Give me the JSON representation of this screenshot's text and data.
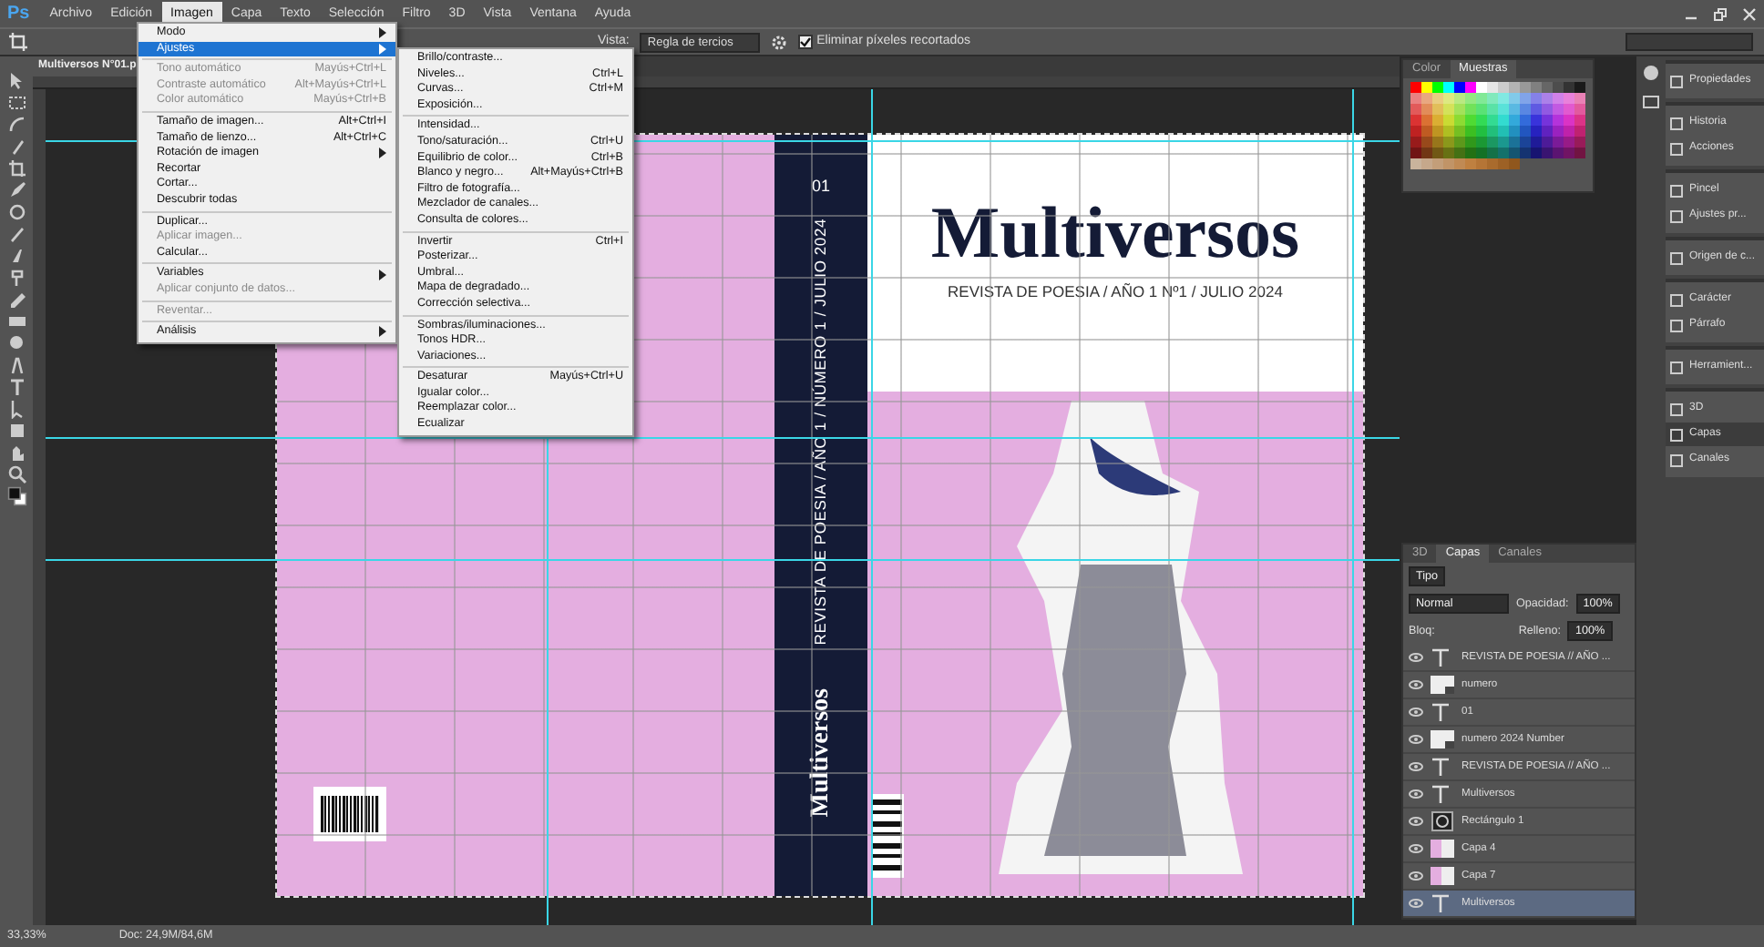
{
  "menubar": {
    "logo": "Ps",
    "items": [
      {
        "label": "Archivo",
        "selected": false
      },
      {
        "label": "Edición",
        "selected": false
      },
      {
        "label": "Imagen",
        "selected": true
      },
      {
        "label": "Capa",
        "selected": false
      },
      {
        "label": "Texto",
        "selected": false
      },
      {
        "label": "Selección",
        "selected": false
      },
      {
        "label": "Filtro",
        "selected": false
      },
      {
        "label": "3D",
        "selected": false
      },
      {
        "label": "Vista",
        "selected": false
      },
      {
        "label": "Ventana",
        "selected": false
      },
      {
        "label": "Ayuda",
        "selected": false
      }
    ]
  },
  "options_bar": {
    "view_label": "Vista:",
    "view_value": "Regla de tercios",
    "delete_pixels": {
      "label": "Eliminar píxeles recortados",
      "checked": true
    }
  },
  "document_tab": {
    "title": "Multiversos N°01.p"
  },
  "image_menu": {
    "items": [
      {
        "kind": "item",
        "label": "Modo",
        "submenu": true,
        "selected": false,
        "disabled": false
      },
      {
        "kind": "item",
        "label": "Ajustes",
        "submenu": true,
        "selected": true,
        "disabled": false
      },
      {
        "kind": "separator"
      },
      {
        "kind": "item",
        "label": "Tono automático",
        "shortcut": "Mayús+Ctrl+L",
        "submenu": false,
        "selected": false,
        "disabled": true
      },
      {
        "kind": "item",
        "label": "Contraste automático",
        "shortcut": "Alt+Mayús+Ctrl+L",
        "submenu": false,
        "selected": false,
        "disabled": true
      },
      {
        "kind": "item",
        "label": "Color automático",
        "shortcut": "Mayús+Ctrl+B",
        "submenu": false,
        "selected": false,
        "disabled": true
      },
      {
        "kind": "separator"
      },
      {
        "kind": "item",
        "label": "Tamaño de imagen...",
        "shortcut": "Alt+Ctrl+I",
        "submenu": false,
        "selected": false,
        "disabled": false
      },
      {
        "kind": "item",
        "label": "Tamaño de lienzo...",
        "shortcut": "Alt+Ctrl+C",
        "submenu": false,
        "selected": false,
        "disabled": false
      },
      {
        "kind": "item",
        "label": "Rotación de imagen",
        "submenu": true,
        "selected": false,
        "disabled": false
      },
      {
        "kind": "item",
        "label": "Recortar",
        "submenu": false,
        "selected": false,
        "disabled": false
      },
      {
        "kind": "item",
        "label": "Cortar...",
        "submenu": false,
        "selected": false,
        "disabled": false
      },
      {
        "kind": "item",
        "label": "Descubrir todas",
        "submenu": false,
        "selected": false,
        "disabled": false
      },
      {
        "kind": "separator"
      },
      {
        "kind": "item",
        "label": "Duplicar...",
        "submenu": false,
        "selected": false,
        "disabled": false
      },
      {
        "kind": "item",
        "label": "Aplicar imagen...",
        "submenu": false,
        "selected": false,
        "disabled": true
      },
      {
        "kind": "item",
        "label": "Calcular...",
        "submenu": false,
        "selected": false,
        "disabled": false
      },
      {
        "kind": "separator"
      },
      {
        "kind": "item",
        "label": "Variables",
        "submenu": true,
        "selected": false,
        "disabled": false
      },
      {
        "kind": "item",
        "label": "Aplicar conjunto de datos...",
        "submenu": false,
        "selected": false,
        "disabled": true
      },
      {
        "kind": "separator"
      },
      {
        "kind": "item",
        "label": "Reventar...",
        "submenu": false,
        "selected": false,
        "disabled": true
      },
      {
        "kind": "separator"
      },
      {
        "kind": "item",
        "label": "Análisis",
        "submenu": true,
        "selected": false,
        "disabled": false
      }
    ]
  },
  "adjustments_submenu": {
    "items": [
      {
        "kind": "item",
        "label": "Brillo/contraste..."
      },
      {
        "kind": "item",
        "label": "Niveles...",
        "shortcut": "Ctrl+L"
      },
      {
        "kind": "item",
        "label": "Curvas...",
        "shortcut": "Ctrl+M"
      },
      {
        "kind": "item",
        "label": "Exposición..."
      },
      {
        "kind": "separator"
      },
      {
        "kind": "item",
        "label": "Intensidad..."
      },
      {
        "kind": "item",
        "label": "Tono/saturación...",
        "shortcut": "Ctrl+U"
      },
      {
        "kind": "item",
        "label": "Equilibrio de color...",
        "shortcut": "Ctrl+B"
      },
      {
        "kind": "item",
        "label": "Blanco y negro...",
        "shortcut": "Alt+Mayús+Ctrl+B"
      },
      {
        "kind": "item",
        "label": "Filtro de fotografía..."
      },
      {
        "kind": "item",
        "label": "Mezclador de canales..."
      },
      {
        "kind": "item",
        "label": "Consulta de colores..."
      },
      {
        "kind": "separator"
      },
      {
        "kind": "item",
        "label": "Invertir",
        "shortcut": "Ctrl+I"
      },
      {
        "kind": "item",
        "label": "Posterizar..."
      },
      {
        "kind": "item",
        "label": "Umbral..."
      },
      {
        "kind": "item",
        "label": "Mapa de degradado..."
      },
      {
        "kind": "item",
        "label": "Corrección selectiva..."
      },
      {
        "kind": "separator"
      },
      {
        "kind": "item",
        "label": "Sombras/iluminaciones..."
      },
      {
        "kind": "item",
        "label": "Tonos HDR..."
      },
      {
        "kind": "item",
        "label": "Variaciones..."
      },
      {
        "kind": "separator"
      },
      {
        "kind": "item",
        "label": "Desaturar",
        "shortcut": "Mayús+Ctrl+U"
      },
      {
        "kind": "item",
        "label": "Igualar color..."
      },
      {
        "kind": "item",
        "label": "Reemplazar color..."
      },
      {
        "kind": "item",
        "label": "Ecualizar"
      }
    ]
  },
  "cover": {
    "spine_number": "01",
    "spine_text": "REVISTA DE POESIA / AÑO 1 / NÚMERO 1 / JULIO 2024",
    "spine_title": "Multiversos",
    "title": "Multiversos",
    "subtitle": "REVISTA DE POESIA / AÑO 1 Nº1 / JULIO 2024"
  },
  "swatches_panel": {
    "tabs": [
      {
        "label": "Color",
        "selected": false
      },
      {
        "label": "Muestras",
        "selected": true
      }
    ]
  },
  "dock": {
    "groups": [
      [
        {
          "label": "Propiedades",
          "selected": false
        }
      ],
      [
        {
          "label": "Historia",
          "selected": false
        },
        {
          "label": "Acciones",
          "selected": false
        }
      ],
      [
        {
          "label": "Pincel",
          "selected": false
        },
        {
          "label": "Ajustes pr...",
          "selected": false
        }
      ],
      [
        {
          "label": "Origen de c...",
          "selected": false
        }
      ],
      [
        {
          "label": "Carácter",
          "selected": false
        },
        {
          "label": "Párrafo",
          "selected": false
        }
      ],
      [
        {
          "label": "Herramient...",
          "selected": false
        }
      ],
      [
        {
          "label": "3D",
          "selected": false
        },
        {
          "label": "Capas",
          "selected": true
        },
        {
          "label": "Canales",
          "selected": false
        }
      ]
    ]
  },
  "layers_panel": {
    "tabs": [
      {
        "label": "3D",
        "selected": false
      },
      {
        "label": "Capas",
        "selected": true
      },
      {
        "label": "Canales",
        "selected": false
      }
    ],
    "filter": "Tipo",
    "blend_mode": "Normal",
    "opacity_label": "Opacidad:",
    "opacity": "100%",
    "lock_label": "Bloq:",
    "fill_label": "Relleno:",
    "fill": "100%",
    "layers": [
      {
        "kind": "text",
        "name": "REVISTA DE POESIA // AÑO ...",
        "selected": false
      },
      {
        "kind": "smart",
        "name": "numero",
        "selected": false
      },
      {
        "kind": "text",
        "name": "01",
        "selected": false
      },
      {
        "kind": "smart",
        "name": "numero 2024 Number",
        "selected": false
      },
      {
        "kind": "text",
        "name": "REVISTA DE POESIA // AÑO ...",
        "selected": false
      },
      {
        "kind": "text",
        "name": "Multiversos",
        "selected": false
      },
      {
        "kind": "shape",
        "name": "Rectángulo 1",
        "selected": false
      },
      {
        "kind": "pixel",
        "name": "Capa 4",
        "selected": false
      },
      {
        "kind": "pixel",
        "name": "Capa 7",
        "selected": false
      },
      {
        "kind": "text",
        "name": "Multiversos",
        "selected": true
      }
    ]
  },
  "status_bar": {
    "zoom": "33,33%",
    "doc_info": "Doc: 24,9M/84,6M"
  }
}
